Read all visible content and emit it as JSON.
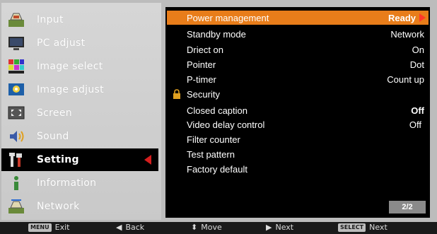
{
  "menu": {
    "items": [
      {
        "label": "Input",
        "icon": "input-icon"
      },
      {
        "label": "PC adjust",
        "icon": "pc-adjust-icon"
      },
      {
        "label": "Image select",
        "icon": "image-select-icon"
      },
      {
        "label": "Image adjust",
        "icon": "image-adjust-icon"
      },
      {
        "label": "Screen",
        "icon": "screen-icon"
      },
      {
        "label": "Sound",
        "icon": "sound-icon"
      },
      {
        "label": "Setting",
        "icon": "setting-icon",
        "selected": true
      },
      {
        "label": "Information",
        "icon": "information-icon"
      },
      {
        "label": "Network",
        "icon": "network-icon"
      }
    ]
  },
  "settings": {
    "rows": [
      {
        "label": "Power management",
        "value": "Ready"
      },
      {
        "label": "Standby mode",
        "value": "Network"
      },
      {
        "label": "Driect on",
        "value": "On"
      },
      {
        "label": "Pointer",
        "value": "Dot"
      },
      {
        "label": "P-timer",
        "value": "Count up"
      },
      {
        "label": "Security",
        "value": ""
      },
      {
        "label": "Closed caption",
        "value": "Off"
      },
      {
        "label": "Video delay control",
        "value": "Off"
      },
      {
        "label": "Filter counter",
        "value": ""
      },
      {
        "label": "Test pattern",
        "value": ""
      },
      {
        "label": "Factory default",
        "value": ""
      }
    ],
    "page": "2/2"
  },
  "bottom_bar": {
    "exit_key": "MENU",
    "exit_label": "Exit",
    "back_label": "Back",
    "move_label": "Move",
    "next_label": "Next",
    "select_key": "SELECT",
    "select_label": "Next"
  },
  "colors": {
    "highlight": "#e87d1a",
    "selected_arrow": "#d51e1e",
    "panel_bg": "#000000"
  }
}
